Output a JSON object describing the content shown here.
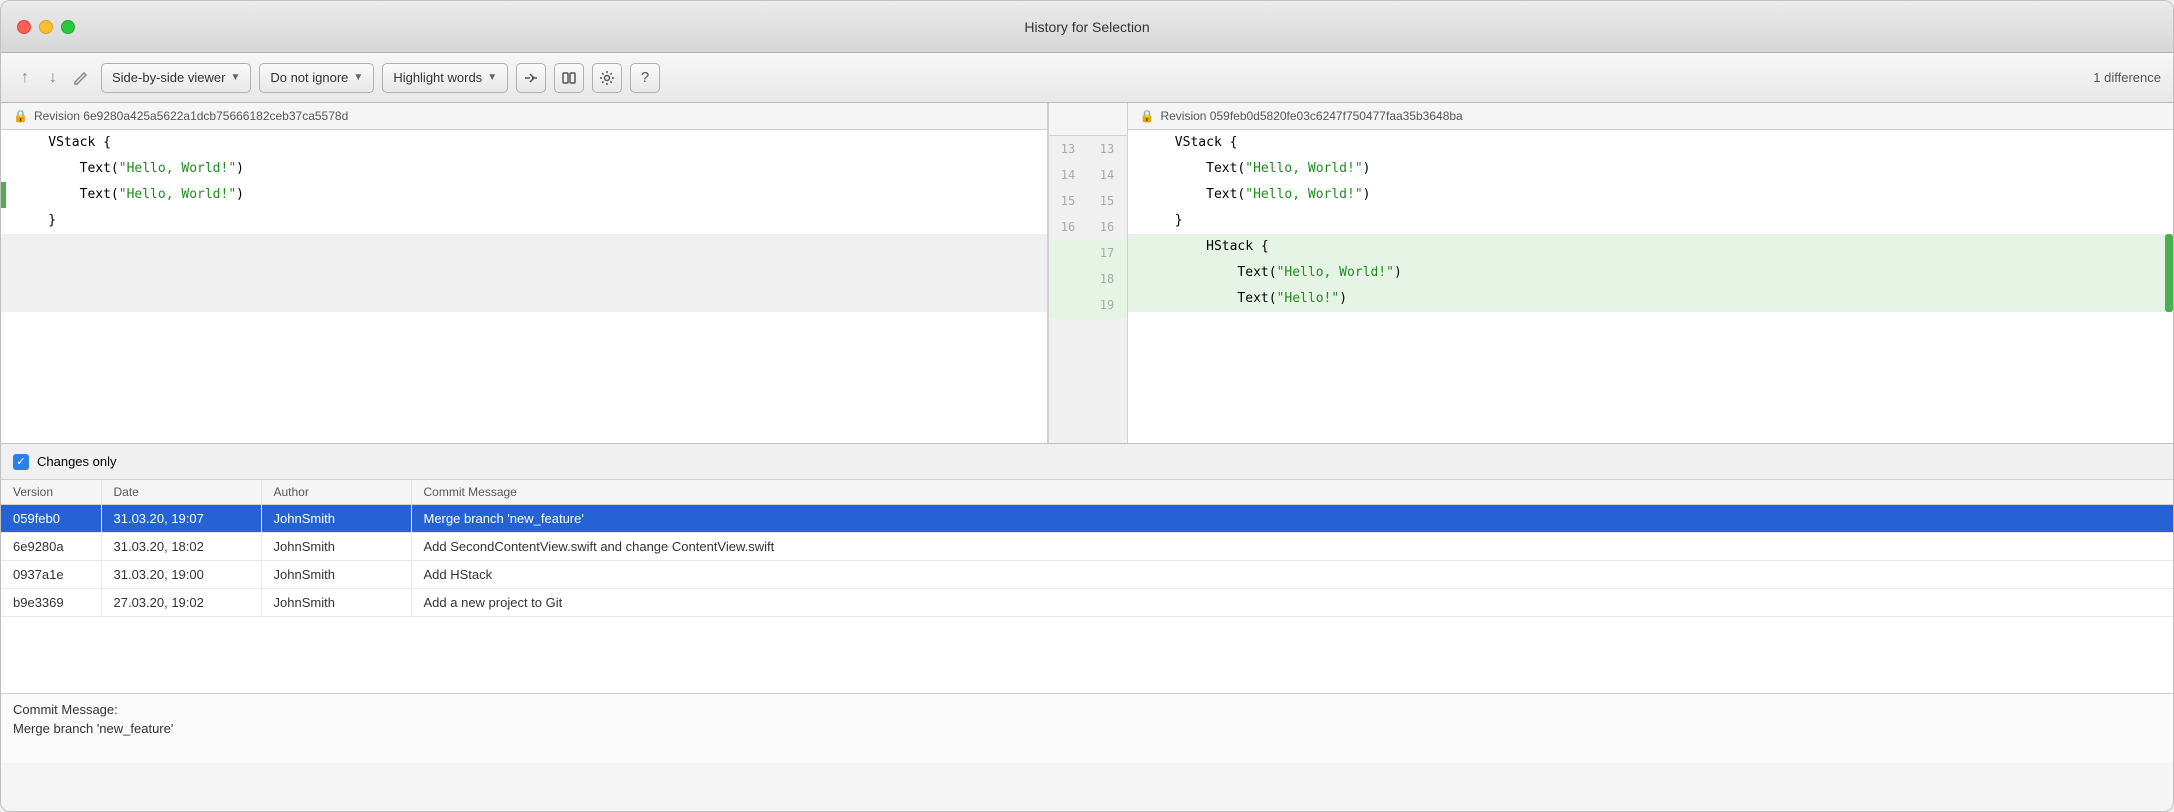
{
  "window": {
    "title": "History for Selection"
  },
  "toolbar": {
    "up_label": "↑",
    "down_label": "↓",
    "edit_label": "✏",
    "viewer_label": "Side-by-side viewer",
    "ignore_label": "Do not ignore",
    "highlight_label": "Highlight words",
    "diff_count": "1 difference"
  },
  "left_pane": {
    "header": "Revision 6e9280a425a5622a1dcb75666182ceb37ca5578d",
    "lines": [
      {
        "num": "",
        "code": "    VStack {"
      },
      {
        "num": "",
        "code": "        Text(\"Hello, World!\")",
        "has_string": true,
        "string_text": "\"Hello, World!\""
      },
      {
        "num": "",
        "code": "        Text(\"Hello, World!\")",
        "has_string": true,
        "string_text": "\"Hello, World!\""
      },
      {
        "num": "",
        "code": "    }"
      },
      {
        "num": "",
        "code": ""
      }
    ]
  },
  "right_pane": {
    "header": "Revision 059feb0d5820fe03c6247f750477faa35b3648ba",
    "lines": [
      {
        "num": "13",
        "right_num": "13",
        "code": "    VStack {",
        "added": false
      },
      {
        "num": "14",
        "right_num": "14",
        "code": "        Text(\"Hello, World!\")",
        "added": false,
        "has_string": true
      },
      {
        "num": "15",
        "right_num": "15",
        "code": "        Text(\"Hello, World!\")",
        "added": false,
        "has_string": true
      },
      {
        "num": "16",
        "right_num": "16",
        "code": "    }",
        "added": false
      },
      {
        "num": "17",
        "right_num": "17",
        "code": "        HStack {",
        "added": true
      },
      {
        "num": "18",
        "right_num": "18",
        "code": "            Text(\"Hello, World!\")",
        "added": true,
        "has_string": true
      },
      {
        "num": "19",
        "right_num": "19",
        "code": "            Text(\"Hello!\")",
        "added": true,
        "has_string": true
      }
    ]
  },
  "gutter_lines": [
    {
      "left": "13",
      "right": "13"
    },
    {
      "left": "14",
      "right": "14"
    },
    {
      "left": "15",
      "right": "15"
    },
    {
      "left": "16",
      "right": "16"
    },
    {
      "left": "",
      "right": "17"
    },
    {
      "left": "",
      "right": "18"
    },
    {
      "left": "",
      "right": "19"
    }
  ],
  "bottom": {
    "changes_only_label": "Changes only",
    "columns": [
      "Version",
      "Date",
      "Author",
      "Commit Message"
    ],
    "rows": [
      {
        "version": "059feb0",
        "date": "31.03.20, 19:07",
        "author": "JohnSmith",
        "message": "Merge branch 'new_feature'",
        "selected": true
      },
      {
        "version": "6e9280a",
        "date": "31.03.20, 18:02",
        "author": "JohnSmith",
        "message": "Add SecondContentView.swift and change ContentView.swift",
        "selected": false
      },
      {
        "version": "0937a1e",
        "date": "31.03.20, 19:00",
        "author": "JohnSmith",
        "message": "Add HStack",
        "selected": false
      },
      {
        "version": "b9e3369",
        "date": "27.03.20, 19:02",
        "author": "JohnSmith",
        "message": "Add a new project to Git",
        "selected": false
      }
    ],
    "commit_label": "Commit Message:",
    "commit_text": "Merge branch 'new_feature'"
  }
}
